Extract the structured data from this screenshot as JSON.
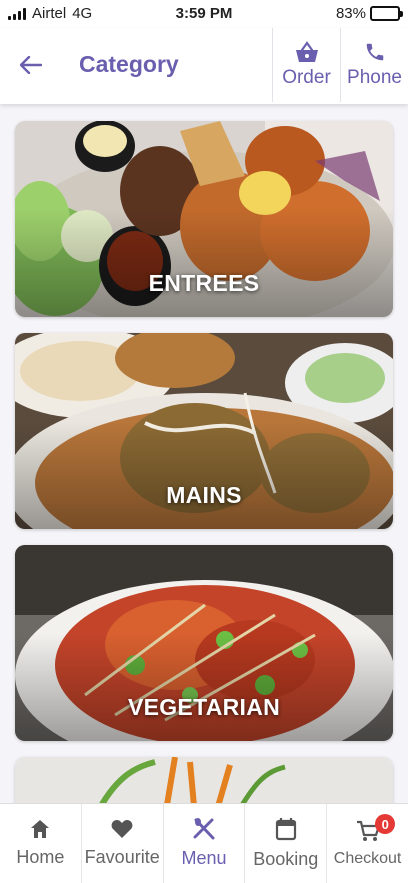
{
  "status_bar": {
    "carrier": "Airtel",
    "network": "4G",
    "time": "3:59 PM",
    "battery": "83%",
    "battery_level": 0.83
  },
  "header": {
    "title": "Category",
    "order_label": "Order",
    "phone_label": "Phone"
  },
  "categories": [
    {
      "label": "ENTREES"
    },
    {
      "label": "MAINS"
    },
    {
      "label": "VEGETARIAN"
    },
    {
      "label": ""
    }
  ],
  "bottom_nav": {
    "items": [
      {
        "label": "Home",
        "icon": "home-icon"
      },
      {
        "label": "Favourite",
        "icon": "heart-icon"
      },
      {
        "label": "Menu",
        "icon": "utensils-icon",
        "active": true
      },
      {
        "label": "Booking",
        "icon": "calendar-icon"
      },
      {
        "label": "Checkout",
        "icon": "cart-icon"
      }
    ],
    "cart_count": "0"
  },
  "colors": {
    "accent": "#6a5fae",
    "badge": "#e53935",
    "battery_fill": "#3cc24a"
  }
}
